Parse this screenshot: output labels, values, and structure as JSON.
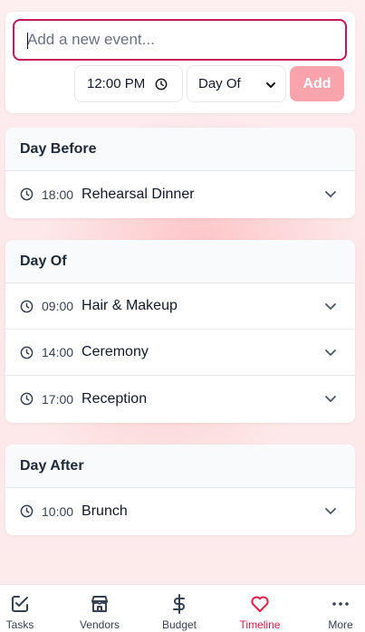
{
  "add_form": {
    "event_placeholder": "Add a new event...",
    "event_value": "",
    "time_value": "12:00 PM",
    "day_select_value": "Day Of",
    "add_label": "Add"
  },
  "sections": [
    {
      "title": "Day Before",
      "events": [
        {
          "time": "18:00",
          "title": "Rehearsal Dinner"
        }
      ]
    },
    {
      "title": "Day Of",
      "events": [
        {
          "time": "09:00",
          "title": "Hair & Makeup"
        },
        {
          "time": "14:00",
          "title": "Ceremony"
        },
        {
          "time": "17:00",
          "title": "Reception"
        }
      ]
    },
    {
      "title": "Day After",
      "events": [
        {
          "time": "10:00",
          "title": "Brunch"
        }
      ]
    }
  ],
  "nav": {
    "items": [
      {
        "label": "Tasks",
        "icon": "checkbox-icon"
      },
      {
        "label": "Vendors",
        "icon": "store-icon"
      },
      {
        "label": "Budget",
        "icon": "dollar-icon"
      },
      {
        "label": "Timeline",
        "icon": "heart-icon"
      },
      {
        "label": "More",
        "icon": "more-dots-icon"
      }
    ],
    "active": "Timeline"
  },
  "colors": {
    "accent": "#e11d48",
    "input_border": "#c2185b",
    "add_button": "#f9a3ad",
    "section_header_bg": "#f8fafc"
  }
}
